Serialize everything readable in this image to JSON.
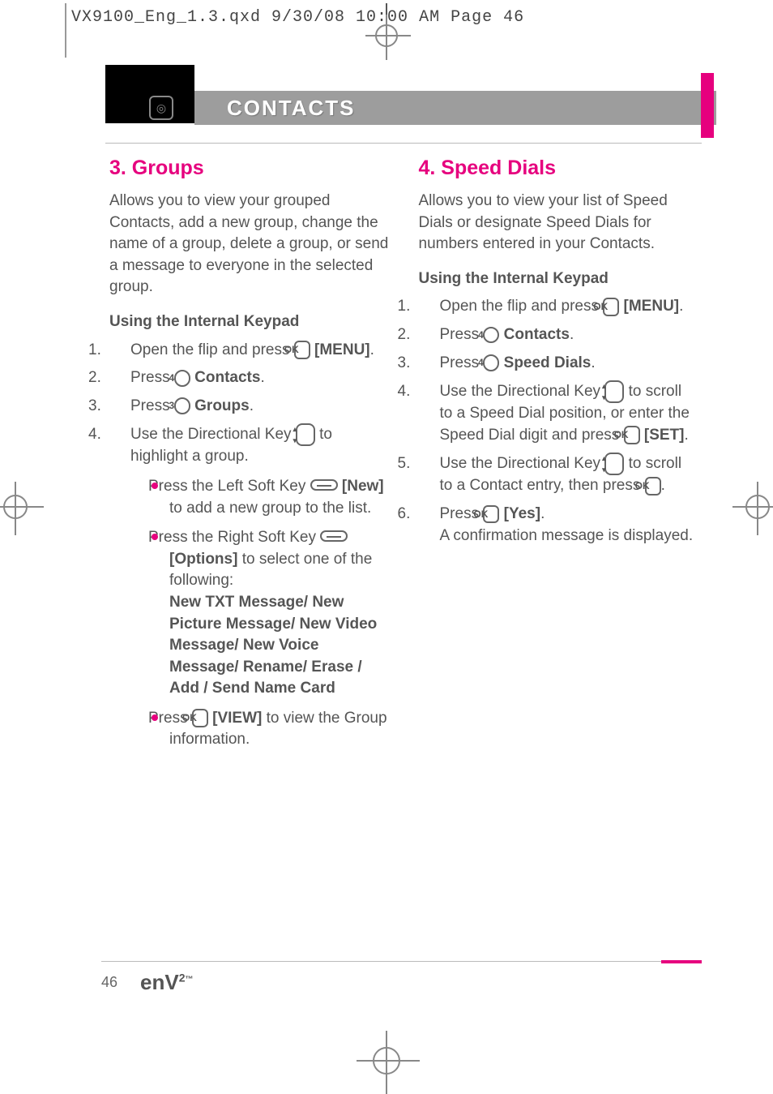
{
  "print_header": "VX9100_Eng_1.3.qxd  9/30/08  10:00 AM  Page 46",
  "chapter_title": "CONTACTS",
  "left": {
    "heading": "3. Groups",
    "intro": "Allows you to view your grouped Contacts, add a new group, change the name of a group, delete a group, or send a message to everyone in the selected group.",
    "sub": "Using the Internal Keypad",
    "step1_a": "Open the flip and press ",
    "step1_menu": "[MENU]",
    "step2_a": "Press ",
    "step2_key": "4",
    "step2_b": "Contacts",
    "step3_a": "Press ",
    "step3_key": "3",
    "step3_b": "Groups",
    "step4_a": "Use the Directional Key ",
    "step4_b": " to highlight a group.",
    "bul1_a": "Press the Left Soft Key ",
    "bul1_new": "[New]",
    "bul1_b": " to add a new group to the list.",
    "bul2_a": "Press the Right Soft Key ",
    "bul2_opt": "[Options]",
    "bul2_b": " to select one of the following:",
    "bul2_list": "New TXT Message/ New Picture Message/ New Video Message/ New Voice Message/ Rename/ Erase / Add / Send Name Card",
    "bul3_a": "Press ",
    "bul3_view": "[VIEW]",
    "bul3_b": " to view the Group information."
  },
  "right": {
    "heading": "4. Speed Dials",
    "intro": "Allows you to view your list of Speed Dials or designate Speed Dials for numbers entered in your Contacts.",
    "sub": "Using the Internal Keypad",
    "step1_a": "Open the flip and press ",
    "step1_menu": "[MENU]",
    "step2_a": "Press ",
    "step2_key": "4",
    "step2_b": "Contacts",
    "step3_a": "Press ",
    "step3_key": "4",
    "step3_b": "Speed Dials",
    "step4_a": "Use the Directional Key ",
    "step4_b": " to scroll to a Speed Dial position, or enter the Speed Dial digit and press ",
    "step4_set": "[SET]",
    "step5_a": "Use the Directional Key ",
    "step5_b": " to scroll to a Contact entry, then press ",
    "step6_a": "Press ",
    "step6_yes": "[Yes]",
    "step6_b": "A confirmation message is displayed."
  },
  "page_number": "46",
  "brand": "enV",
  "icons": {
    "ok": "OK"
  }
}
